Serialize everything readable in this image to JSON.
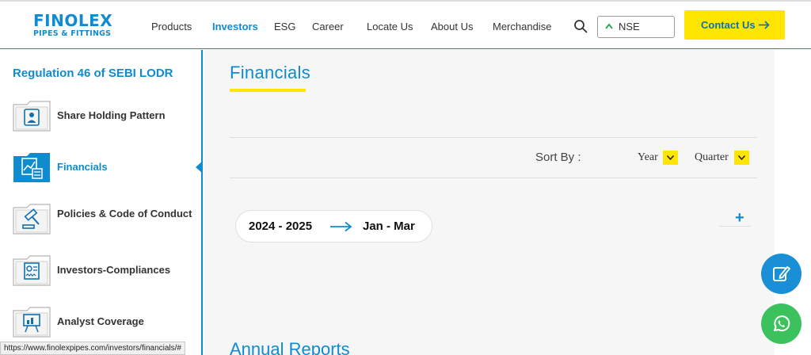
{
  "brand": {
    "name": "FINOLEX",
    "tagline": "PIPES & FITTINGS",
    "color": "#0f8bd0",
    "accent": "#ffe500"
  },
  "nav": {
    "items": [
      "Products",
      "Investors",
      "ESG",
      "Career",
      "Locate Us",
      "About Us",
      "Merchandise"
    ],
    "active": "Investors",
    "search_icon": "search-icon"
  },
  "stock": {
    "exchange": "NSE",
    "trend_icon": "caret-up-icon"
  },
  "contact": {
    "label": "Contact Us"
  },
  "sidebar": {
    "title": "Regulation 46 of SEBI LODR",
    "items": [
      {
        "label": "Share Holding Pattern",
        "icon": "id-card-icon"
      },
      {
        "label": "Financials",
        "icon": "financial-chart-icon",
        "active": true
      },
      {
        "label": "Policies & Code of Conduct",
        "icon": "gavel-icon"
      },
      {
        "label": "Investors-Compliances",
        "icon": "certificate-icon"
      },
      {
        "label": "Analyst Coverage",
        "icon": "presentation-icon"
      }
    ]
  },
  "main": {
    "title": "Financials",
    "sort": {
      "label": "Sort By :",
      "year_label": "Year",
      "quarter_label": "Quarter"
    },
    "period": {
      "year": "2024 - 2025",
      "quarter": "Jan - Mar"
    },
    "expand_icon": "+",
    "next_section_title": "Annual Reports"
  },
  "floating": {
    "edit_icon": "edit-icon",
    "whatsapp_icon": "whatsapp-icon"
  },
  "statusbar": {
    "url": "https://www.finolexpipes.com/investors/financials/#"
  }
}
